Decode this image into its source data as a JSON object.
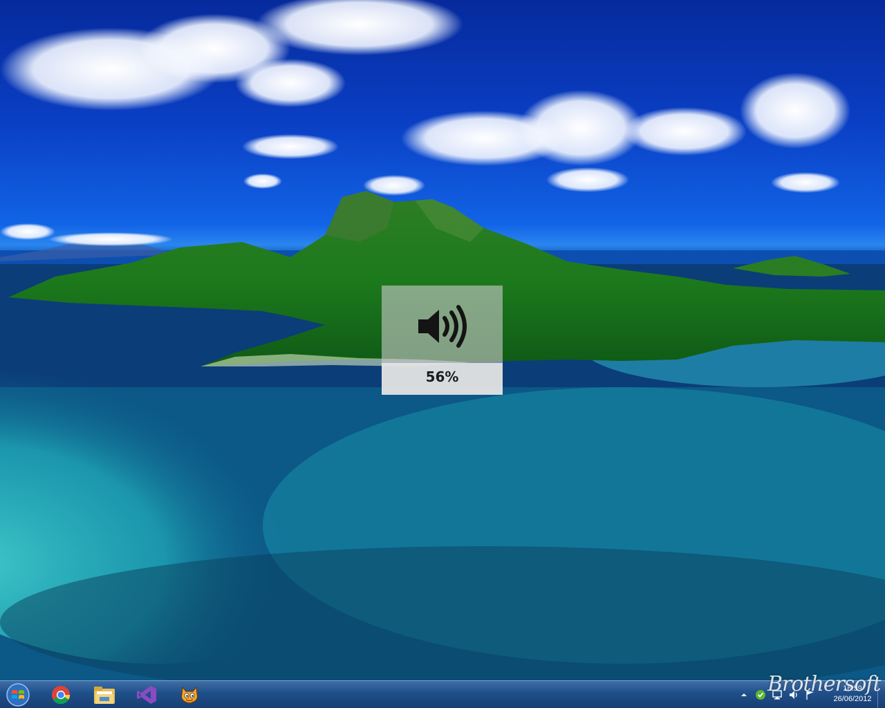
{
  "osd": {
    "volume_percent": "56%",
    "icon": "speaker-icon"
  },
  "taskbar": {
    "start_icon": "windows-start-icon",
    "pinned": [
      {
        "name": "chrome-icon"
      },
      {
        "name": "file-explorer-icon"
      },
      {
        "name": "visual-studio-icon"
      },
      {
        "name": "scratch-cat-icon"
      }
    ],
    "tray": {
      "icons": [
        "show-hidden-icons-icon",
        "check-shield-icon",
        "network-icon",
        "volume-icon",
        "flag-icon"
      ],
      "time": "16:59",
      "date": "26/06/2012"
    }
  },
  "watermark": "Brothersoft",
  "colors": {
    "taskbar": "#1f4f8a",
    "osd_bg": "#c8c8c8"
  }
}
